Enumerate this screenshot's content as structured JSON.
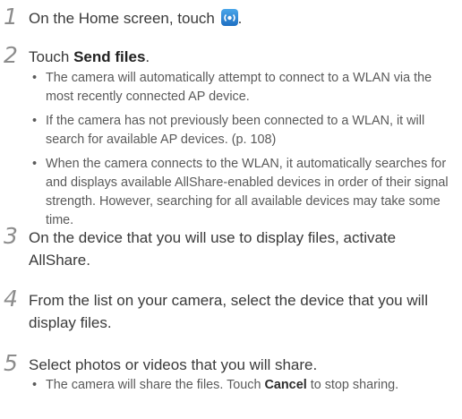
{
  "steps": [
    {
      "num": "1",
      "text_before": "On the Home screen, touch",
      "text_after": ".",
      "icon": "allshare-wifi-icon"
    },
    {
      "num": "2",
      "text_before": "Touch ",
      "bold": "Send files",
      "text_after": ".",
      "bullets": [
        "The camera will automatically attempt to connect to a WLAN via the most recently connected AP device.",
        "If the camera has not previously been connected to a WLAN, it will search for available AP devices. (p. 108)",
        "When the camera connects to the WLAN, it automatically searches for and displays available AllShare-enabled devices in order of their signal strength. However, searching for all available devices may take some time."
      ]
    },
    {
      "num": "3",
      "text": "On the device that you will use to display files, activate AllShare."
    },
    {
      "num": "4",
      "text": "From the list on your camera, select the device that you will display files."
    },
    {
      "num": "5",
      "text": "Select photos or videos that you will share.",
      "bullet": {
        "before": "The camera will share the files. Touch ",
        "bold": "Cancel",
        "after": " to stop sharing."
      }
    }
  ],
  "bullet_char": "•"
}
